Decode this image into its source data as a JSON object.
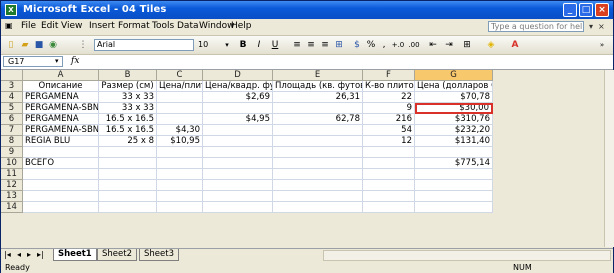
{
  "window": {
    "title": "Microsoft Excel - 04 Tiles",
    "app_icon": "excel-icon"
  },
  "menu": {
    "items": [
      "File",
      "Edit",
      "View",
      "Insert",
      "Format",
      "Tools",
      "Data",
      "Window",
      "Help"
    ],
    "question_placeholder": "Type a question for help"
  },
  "toolbar": {
    "font": "Arial",
    "size": "10",
    "bold": "B",
    "italic": "I",
    "underline": "U",
    "percent": "%",
    "comma": ","
  },
  "formula_bar": {
    "name_box": "G17",
    "fx": "fx",
    "value": ""
  },
  "grid": {
    "columns": [
      "A",
      "B",
      "C",
      "D",
      "E",
      "F",
      "G"
    ],
    "selected_column": "G",
    "rows": [
      {
        "num": "3",
        "cells": [
          "Описание",
          "Размер (см)",
          "Цена/плитка",
          "Цена/квадр. фут",
          "Площадь (кв. футов)",
          "К-во плиток",
          "Цена (долларов США)"
        ]
      },
      {
        "num": "4",
        "cells": [
          "PERGAMENA",
          "33 x 33",
          "",
          "$2,69",
          "26,31",
          "22",
          "$70,78"
        ]
      },
      {
        "num": "5",
        "cells": [
          "PERGAMENA-SBN",
          "33 x 33",
          "",
          "",
          "",
          "9",
          "$30,00"
        ]
      },
      {
        "num": "6",
        "cells": [
          "PERGAMENA",
          "16.5 x 16.5",
          "",
          "$4,95",
          "62,78",
          "216",
          "$310,76"
        ]
      },
      {
        "num": "7",
        "cells": [
          "PERGAMENA-SBN",
          "16.5 x 16.5",
          "$4,30",
          "",
          "",
          "54",
          "$232,20"
        ]
      },
      {
        "num": "8",
        "cells": [
          "REGIA BLU",
          "25 x 8",
          "$10,95",
          "",
          "",
          "12",
          "$131,40"
        ]
      },
      {
        "num": "9",
        "cells": [
          "",
          "",
          "",
          "",
          "",
          "",
          ""
        ]
      },
      {
        "num": "10",
        "cells": [
          "ВСЕГО",
          "",
          "",
          "",
          "",
          "",
          "$775,14"
        ]
      },
      {
        "num": "11",
        "cells": [
          "",
          "",
          "",
          "",
          "",
          "",
          ""
        ]
      },
      {
        "num": "12",
        "cells": [
          "",
          "",
          "",
          "",
          "",
          "",
          ""
        ]
      },
      {
        "num": "13",
        "cells": [
          "",
          "",
          "",
          "",
          "",
          "",
          ""
        ]
      },
      {
        "num": "14",
        "cells": [
          "",
          "",
          "",
          "",
          "",
          "",
          ""
        ]
      }
    ]
  },
  "sheets": {
    "tabs": [
      "Sheet1",
      "Sheet2",
      "Sheet3"
    ],
    "active": "Sheet1"
  },
  "status": {
    "left": "Ready",
    "right": "NUM"
  },
  "colors": {
    "highlight_border": "#d9302a",
    "title_bar": "#0b5ad9",
    "selected_header": "#f8c86c"
  }
}
